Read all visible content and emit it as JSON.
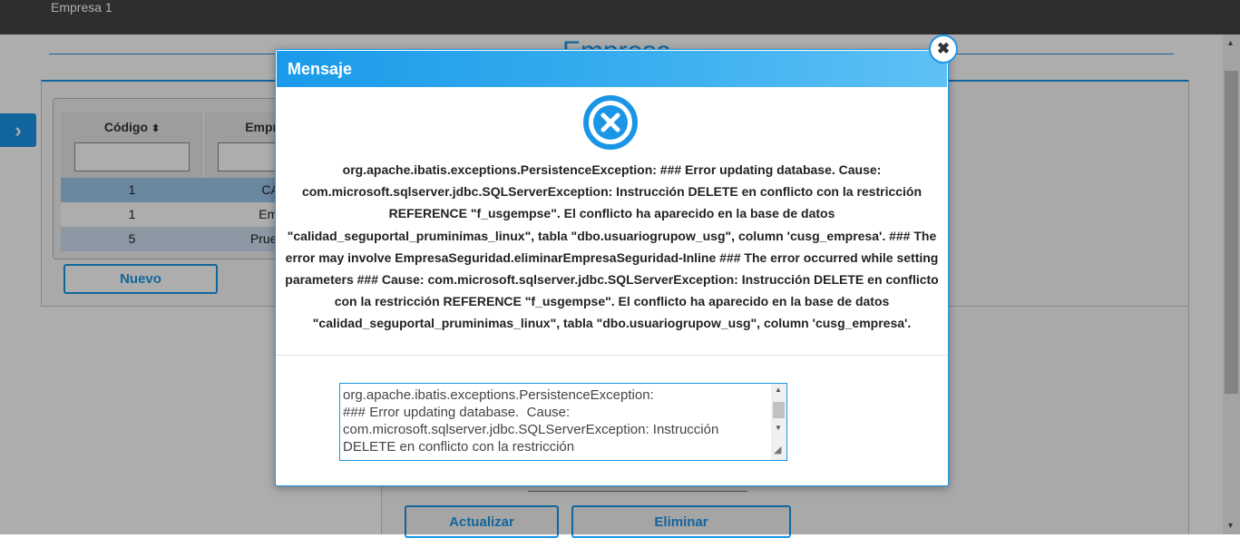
{
  "topbar": {
    "company": "Empresa 1"
  },
  "page": {
    "title": "Empresa"
  },
  "grid": {
    "columns": [
      {
        "label": "Código",
        "sort_icon": "sort-icon"
      },
      {
        "label": "Empre"
      }
    ],
    "rows": [
      {
        "code": "1",
        "name": "CAL",
        "bg": "#9cc8ec"
      },
      {
        "code": "1",
        "name": "Empr",
        "bg": "#ffffff"
      },
      {
        "code": "5",
        "name": "Pruebas",
        "bg": "#cfe1f2"
      }
    ]
  },
  "buttons": {
    "new": "Nuevo",
    "update": "Actualizar",
    "delete": "Eliminar"
  },
  "dialog": {
    "title": "Mensaje",
    "close_glyph": "✖",
    "message": "org.apache.ibatis.exceptions.PersistenceException: ### Error updating database. Cause: com.microsoft.sqlserver.jdbc.SQLServerException: Instrucción DELETE en conflicto con la restricción REFERENCE \"f_usgempse\". El conflicto ha aparecido en la base de datos \"calidad_seguportal_pruminimas_linux\", tabla \"dbo.usuariogrupow_usg\", column 'cusg_empresa'. ### The error may involve EmpresaSeguridad.eliminarEmpresaSeguridad-Inline ### The error occurred while setting parameters ### Cause: com.microsoft.sqlserver.jdbc.SQLServerException: Instrucción DELETE en conflicto con la restricción REFERENCE \"f_usgempse\". El conflicto ha aparecido en la base de datos \"calidad_seguportal_pruminimas_linux\", tabla \"dbo.usuariogrupow_usg\", column 'cusg_empresa'.",
    "detail": "org.apache.ibatis.exceptions.PersistenceException: \n### Error updating database.  Cause: com.microsoft.sqlserver.jdbc.SQLServerException: Instrucción DELETE en conflicto con la restricción"
  },
  "colors": {
    "accent": "#1b96e6",
    "topbar": "#454545"
  }
}
